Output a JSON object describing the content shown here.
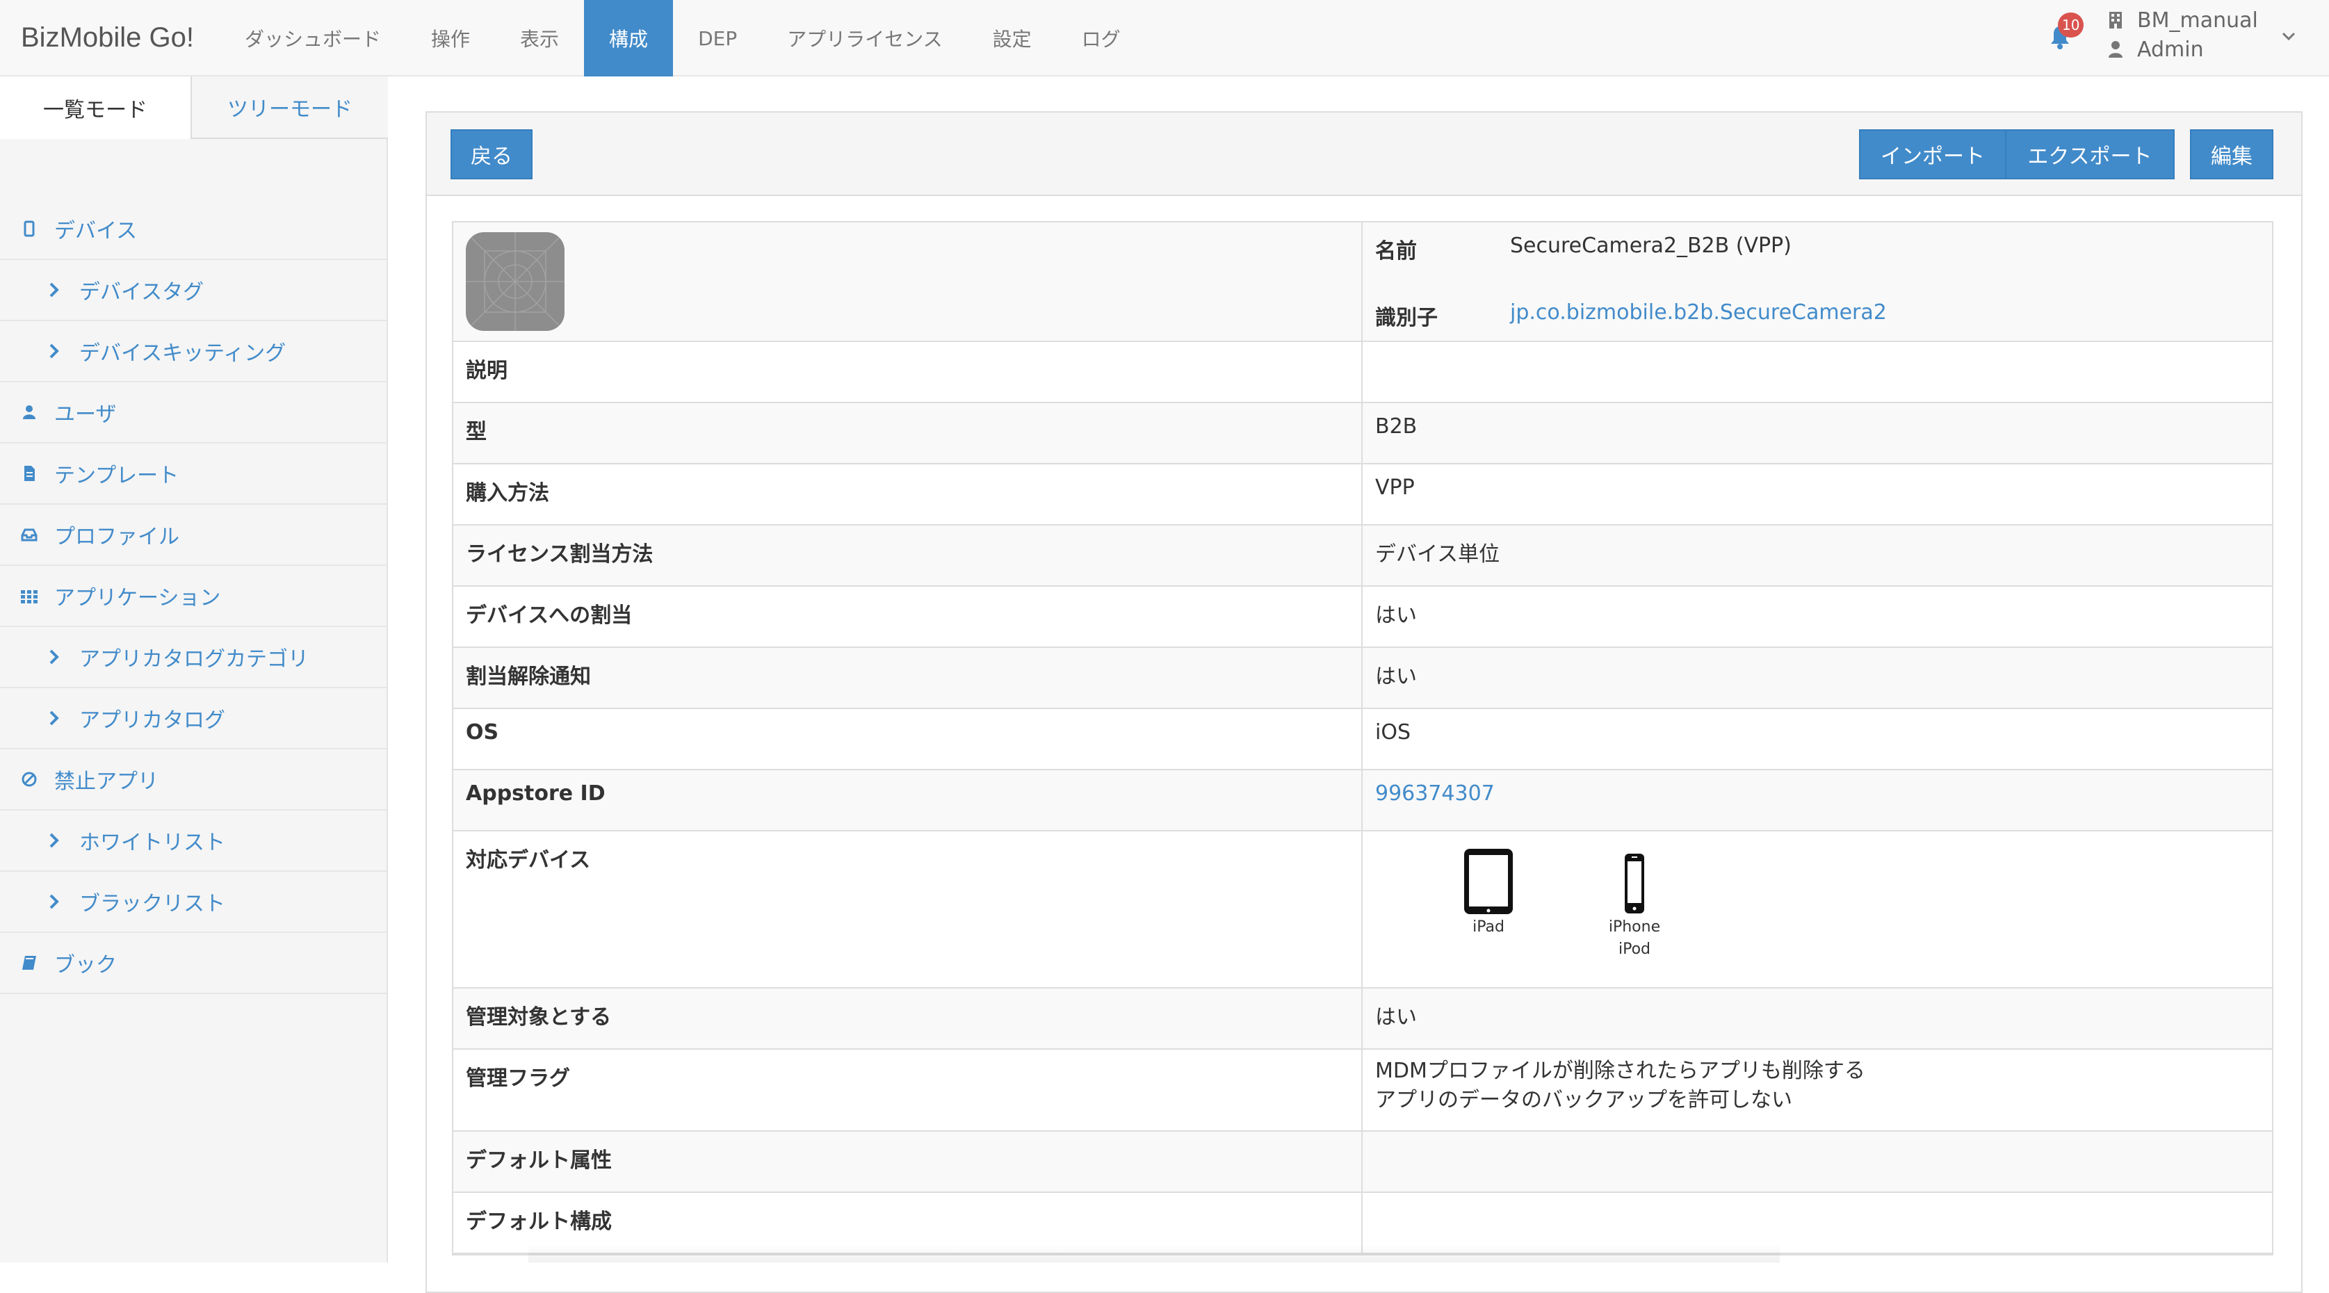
{
  "navbar": {
    "brand": "BizMobile Go!",
    "items": [
      "ダッシュボード",
      "操作",
      "表示",
      "構成",
      "DEP",
      "アプリライセンス",
      "設定",
      "ログ"
    ],
    "active_index": 3,
    "notification_count": "10",
    "user_name": "BM_manual",
    "user_role": "Admin"
  },
  "sidebar": {
    "mode_tabs": [
      "一覧モード",
      "ツリーモード"
    ],
    "items": [
      {
        "label": "デバイス",
        "icon": "mobile-icon",
        "level": "top"
      },
      {
        "label": "デバイスタグ",
        "icon": "chevron-right-icon",
        "level": "sub"
      },
      {
        "label": "デバイスキッティング",
        "icon": "chevron-right-icon",
        "level": "sub"
      },
      {
        "label": "ユーザ",
        "icon": "user-icon",
        "level": "top"
      },
      {
        "label": "テンプレート",
        "icon": "file-icon",
        "level": "top"
      },
      {
        "label": "プロファイル",
        "icon": "inbox-icon",
        "level": "top"
      },
      {
        "label": "アプリケーション",
        "icon": "grid-icon",
        "level": "top"
      },
      {
        "label": "アプリカタログカテゴリ",
        "icon": "chevron-right-icon",
        "level": "sub"
      },
      {
        "label": "アプリカタログ",
        "icon": "chevron-right-icon",
        "level": "sub"
      },
      {
        "label": "禁止アプリ",
        "icon": "ban-icon",
        "level": "top"
      },
      {
        "label": "ホワイトリスト",
        "icon": "chevron-right-icon",
        "level": "sub"
      },
      {
        "label": "ブラックリスト",
        "icon": "chevron-right-icon",
        "level": "sub"
      },
      {
        "label": "ブック",
        "icon": "book-icon",
        "level": "top"
      }
    ]
  },
  "toolbar": {
    "back_label": "戻る",
    "import_label": "インポート",
    "export_label": "エクスポート",
    "edit_label": "編集"
  },
  "detail": {
    "name_key": "名前",
    "name_value": "SecureCamera2_B2B (VPP)",
    "id_key": "識別子",
    "id_value": "jp.co.bizmobile.b2b.SecureCamera2",
    "rows": [
      {
        "key": "説明",
        "value": ""
      },
      {
        "key": "型",
        "value": "B2B"
      },
      {
        "key": "購入方法",
        "value": "VPP"
      },
      {
        "key": "ライセンス割当方法",
        "value": "デバイス単位"
      },
      {
        "key": "デバイスへの割当",
        "value": "はい"
      },
      {
        "key": "割当解除通知",
        "value": "はい"
      },
      {
        "key": "OS",
        "value": "iOS"
      },
      {
        "key": "Appstore ID",
        "value": "996374307"
      }
    ],
    "devices_key": "対応デバイス",
    "devices": [
      {
        "label1": "iPad",
        "label2": ""
      },
      {
        "label1": "iPhone",
        "label2": "iPod"
      }
    ],
    "managed_key": "管理対象とする",
    "managed_value": "はい",
    "flags_key": "管理フラグ",
    "flags": [
      "MDMプロファイルが削除されたらアプリも削除する",
      "アプリのデータのバックアップを許可しない"
    ],
    "default_attr_key": "デフォルト属性",
    "default_attr_value": "",
    "default_config_key": "デフォルト構成",
    "default_config_value": ""
  }
}
